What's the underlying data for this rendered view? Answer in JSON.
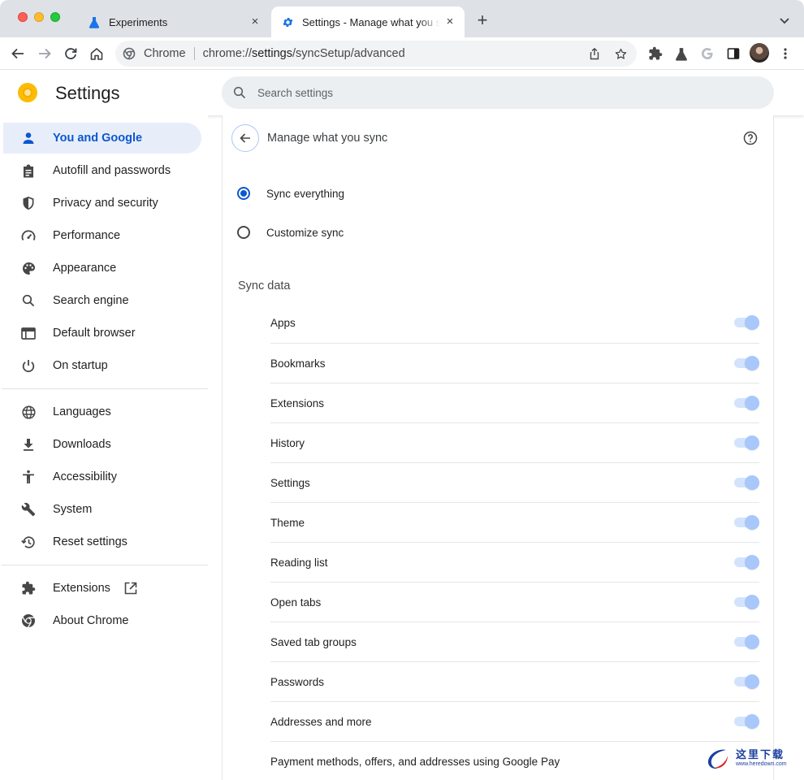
{
  "browser": {
    "tabs": [
      {
        "title": "Experiments",
        "icon": "flask-icon",
        "active": false
      },
      {
        "title": "Settings - Manage what you sync",
        "icon": "gear-icon",
        "active": true
      }
    ],
    "new_tab_label": "+",
    "omnibox": {
      "chip": "Chrome",
      "url_prefix": "chrome://",
      "url_host": "settings",
      "url_path": "/syncSetup/advanced"
    },
    "toolbar_icons": [
      "back-arrow-icon",
      "forward-arrow-icon",
      "reload-icon",
      "home-icon",
      "share-icon",
      "star-icon",
      "extensions-puzzle-icon",
      "flask-icon",
      "google-g-icon",
      "side-panel-icon",
      "avatar",
      "kebab-menu-icon"
    ]
  },
  "settings": {
    "title": "Settings",
    "search_placeholder": "Search settings",
    "nav": [
      {
        "label": "You and Google",
        "icon": "person-icon",
        "active": true
      },
      {
        "label": "Autofill and passwords",
        "icon": "clipboard-icon"
      },
      {
        "label": "Privacy and security",
        "icon": "shield-icon"
      },
      {
        "label": "Performance",
        "icon": "speedometer-icon"
      },
      {
        "label": "Appearance",
        "icon": "palette-icon"
      },
      {
        "label": "Search engine",
        "icon": "search-icon"
      },
      {
        "label": "Default browser",
        "icon": "browser-window-icon"
      },
      {
        "label": "On startup",
        "icon": "power-icon"
      },
      {
        "label": "Languages",
        "icon": "globe-icon"
      },
      {
        "label": "Downloads",
        "icon": "download-icon"
      },
      {
        "label": "Accessibility",
        "icon": "accessibility-icon"
      },
      {
        "label": "System",
        "icon": "wrench-icon"
      },
      {
        "label": "Reset settings",
        "icon": "history-icon"
      },
      {
        "label": "Extensions",
        "icon": "puzzle-icon"
      },
      {
        "label": "About Chrome",
        "icon": "chrome-logo-icon"
      }
    ]
  },
  "sync_page": {
    "title": "Manage what you sync",
    "options": [
      {
        "label": "Sync everything",
        "checked": true
      },
      {
        "label": "Customize sync",
        "checked": false
      }
    ],
    "section_title": "Sync data",
    "items": [
      {
        "label": "Apps",
        "enabled": true
      },
      {
        "label": "Bookmarks",
        "enabled": true
      },
      {
        "label": "Extensions",
        "enabled": true
      },
      {
        "label": "History",
        "enabled": true
      },
      {
        "label": "Settings",
        "enabled": true
      },
      {
        "label": "Theme",
        "enabled": true
      },
      {
        "label": "Reading list",
        "enabled": true
      },
      {
        "label": "Open tabs",
        "enabled": true
      },
      {
        "label": "Saved tab groups",
        "enabled": true
      },
      {
        "label": "Passwords",
        "enabled": true
      },
      {
        "label": "Addresses and more",
        "enabled": true
      },
      {
        "label": "Payment methods, offers, and addresses using Google Pay",
        "enabled": true
      }
    ]
  },
  "watermark": {
    "chinese": "这里下载",
    "url": "www.heredown.com"
  },
  "colors": {
    "accent": "#0b57d0",
    "nav_active_bg": "#e8eef9",
    "toggle_track": "#d3e3fd",
    "toggle_knob": "#a8c7fa",
    "tabstrip": "#dee1e6"
  }
}
